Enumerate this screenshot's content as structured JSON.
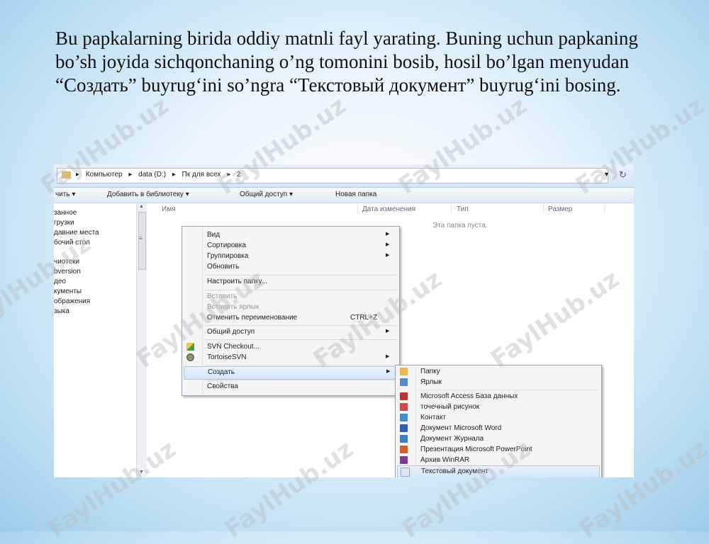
{
  "slide": {
    "text": "Bu papkalarning birida oddiy matnli fayl yarating. Buning uchun papkaning bo’sh joyida sichqonchaning o’ng tomonini bosib, hosil bo’lgan menyudan “Создать” buyrug‘ini so’ngra “Текстовый документ” buyrug‘ini bosing."
  },
  "explorer": {
    "breadcrumbs": [
      "Компьютер",
      "data (D:)",
      "Пк для всех",
      "2"
    ],
    "toolbar": [
      "чить ▾",
      "Добавить в библиотеку ▾",
      "Общий доступ ▾",
      "Новая папка"
    ],
    "nav_items": [
      "занное",
      "грузки",
      "давние места",
      "бочий стол",
      "чиотеки",
      "bversion",
      "део",
      "кументы",
      "ображения",
      "зыка"
    ],
    "columns": [
      "Имя",
      "Дата изменения",
      "Тип",
      "Размер"
    ],
    "empty_text": "Эта папка пуста."
  },
  "context_menu": {
    "items": [
      {
        "label": "Вид",
        "arrow": "▶"
      },
      {
        "label": "Сортировка",
        "arrow": "▶"
      },
      {
        "label": "Группировка",
        "arrow": "▶"
      },
      {
        "label": "Обновить"
      },
      {
        "label": "Настроить папку..."
      },
      {
        "label": "Вставить",
        "disabled": true
      },
      {
        "label": "Вставить ярлык",
        "disabled": true
      },
      {
        "label": "Отменить переименование",
        "shortcut": "CTRL+Z"
      },
      {
        "label": "Общий доступ",
        "arrow": "▶"
      },
      {
        "label": "SVN Checkout...",
        "icon": "svn-checkout-icon"
      },
      {
        "label": "TortoiseSVN",
        "icon": "tortoisesvn-icon",
        "arrow": "▶"
      },
      {
        "label": "Создать",
        "arrow": "▶",
        "highlighted": true
      },
      {
        "label": "Свойства"
      }
    ]
  },
  "submenu": {
    "items": [
      {
        "label": "Папку",
        "icon": "folder-icon",
        "color": "#e6b94a"
      },
      {
        "label": "Ярлык",
        "icon": "shortcut-icon",
        "color": "#5b86c8"
      },
      {
        "label": "Microsoft Access База данных",
        "icon": "access-icon",
        "color": "#b03a3a"
      },
      {
        "label": "точечный рисунок",
        "icon": "bitmap-icon",
        "color": "#c84a4a"
      },
      {
        "label": "Контакт",
        "icon": "contact-icon",
        "color": "#4a8ac8"
      },
      {
        "label": "Документ Microsoft Word",
        "icon": "word-icon",
        "color": "#2f5fb3"
      },
      {
        "label": "Документ Журнала",
        "icon": "journal-icon",
        "color": "#3f7fc0"
      },
      {
        "label": "Презентация Microsoft PowerPoint",
        "icon": "powerpoint-icon",
        "color": "#d0602a"
      },
      {
        "label": "Архив WinRAR",
        "icon": "winrar-icon",
        "color": "#7a3f8c"
      },
      {
        "label": "Текстовый документ",
        "icon": "text-document-icon",
        "color": "#dfe6ee",
        "highlighted": true
      }
    ]
  },
  "watermark": "FaylHub.uz"
}
